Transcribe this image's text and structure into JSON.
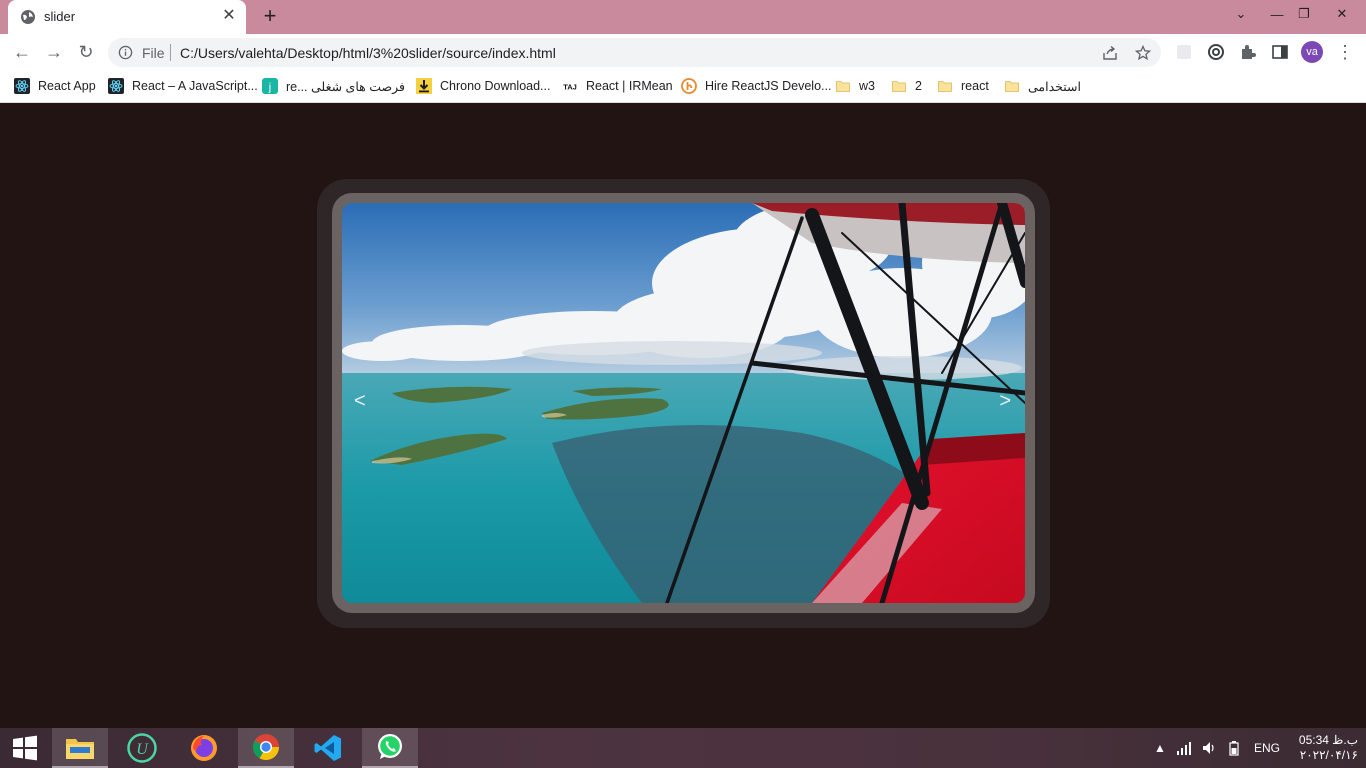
{
  "browser": {
    "tab": {
      "title": "slider",
      "close_glyph": "✕"
    },
    "new_tab_glyph": "+",
    "window_controls": {
      "tab_search": "⌄",
      "minimize": "—",
      "restore": "❐",
      "close": "✕"
    },
    "address": {
      "scheme": "File",
      "url": "C:/Users/valehta/Desktop/html/3%20slider/source/index.html"
    },
    "profile_initials": "va",
    "menu_glyph": "⋮",
    "nav": {
      "back": "←",
      "forward": "→",
      "reload": "↻"
    },
    "accent": "#c98a9e"
  },
  "bookmarks": [
    {
      "label": "React App",
      "icon": "react-icon"
    },
    {
      "label": "React – A JavaScript...",
      "icon": "react-icon"
    },
    {
      "label": "re... فرصت های شغلی",
      "icon": "jobinja-icon"
    },
    {
      "label": "Chrono Download...",
      "icon": "download-icon"
    },
    {
      "label": "React | IRMean",
      "icon": "irmean-icon"
    },
    {
      "label": "Hire ReactJS Develo...",
      "icon": "toptal-icon"
    },
    {
      "label": "w3",
      "icon": "folder-icon"
    },
    {
      "label": "2",
      "icon": "folder-icon"
    },
    {
      "label": "react",
      "icon": "folder-icon"
    },
    {
      "label": "استخدامی",
      "icon": "folder-icon"
    }
  ],
  "slider": {
    "prev_arrow": "<",
    "next_arrow": ">",
    "image": "aerial-islands-from-biplane-photo"
  },
  "taskbar": {
    "apps": [
      "start-icon",
      "file-explorer-icon",
      "upwork-icon",
      "firefox-icon",
      "chrome-icon",
      "vscode-icon",
      "whatsapp-icon"
    ],
    "language": "ENG",
    "time": "05:34 ب.ظ",
    "date": "۲۰۲۲/۰۴/۱۶"
  }
}
